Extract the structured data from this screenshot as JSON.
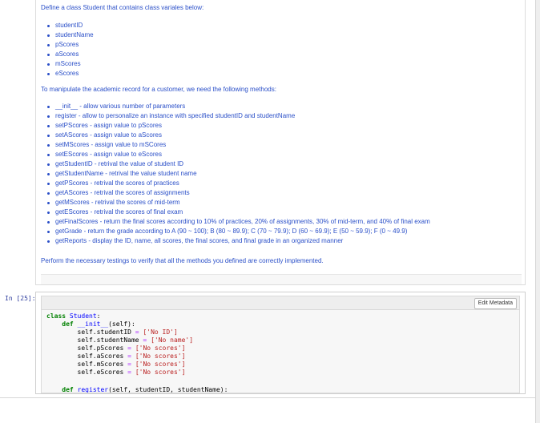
{
  "markdown": {
    "intro": "Define a class Student that contains class variales below:",
    "variables": [
      "studentID",
      "studentName",
      "pScores",
      "aScores",
      "mScores",
      "eScores"
    ],
    "methods_intro": "To manipulate the academic record for a customer, we need the following methods:",
    "methods": [
      "__init__ - allow various number of parameters",
      "register - allow to personalize an instance with specified studentID and studentName",
      "setPScores - assign value to pScores",
      "setAScores - assign value to aScores",
      "setMScores - assign value to mSCores",
      "setEScores - assign value to eScores",
      "getStudentID - retrival the value of student ID",
      "getStudentName - retrival the value student name",
      "getPScores - retrival the scores of practices",
      "getAScores - retrival the scores of assignments",
      "getMScores - retrival the scores of mid-term",
      "getEScores - retrival the scores of final exam",
      "getFinalScores - return the final scores according to 10% of practices, 20% of assignments, 30% of mid-term, and 40% of final exam",
      "getGrade - return the grade according to A (90 ~ 100); B (80 ~ 89.9); C (70 ~ 79.9); D (60 ~ 69.9); E (50 ~ 59.9); F (0 ~ 49.9)",
      "getReports - display the ID, name, all scores, the final scores, and final grade in an organized manner"
    ],
    "footer": "Perform the necessary testings to verify that all the methods you defined are correctly implemented."
  },
  "code_cell": {
    "prompt": "In [25]:",
    "edit_metadata_label": "Edit Metadata",
    "lines": {
      "class_kw": "class",
      "class_name": "Student",
      "class_colon": ":",
      "def1_kw": "def",
      "def1_name": "__init__",
      "def1_args": "(self):",
      "a1_lhs": "self.studentID",
      "a1_val": "['No ID']",
      "a2_lhs": "self.studentName",
      "a2_val": "['No name']",
      "a3_lhs": "self.pScores",
      "a3_val": "['No scores']",
      "a4_lhs": "self.aScores",
      "a4_val": "['No scores']",
      "a5_lhs": "self.mScores",
      "a5_val": "['No scores']",
      "a6_lhs": "self.eScores",
      "a6_val": "['No scores']",
      "eq": "=",
      "def2_kw": "def",
      "def2_name": "register",
      "def2_args": "(self, studentID, studentName):"
    }
  }
}
